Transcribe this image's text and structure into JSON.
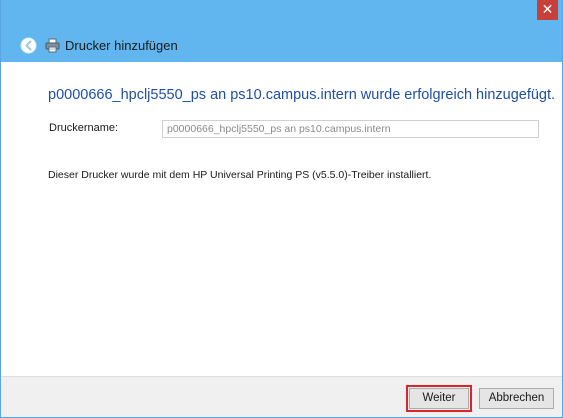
{
  "window": {
    "title": "Drucker hinzufügen",
    "close_symbol": "✕"
  },
  "content": {
    "headline": "p0000666_hpclj5550_ps an ps10.campus.intern wurde erfolgreich hinzugefügt.",
    "printer_name_label": "Druckername:",
    "printer_name_value": "p0000666_hpclj5550_ps an ps10.campus.intern",
    "info_text": "Dieser Drucker wurde mit dem HP Universal Printing PS (v5.5.0)-Treiber installiert."
  },
  "footer": {
    "next_label": "Weiter",
    "cancel_label": "Abbrechen"
  },
  "colors": {
    "titlebar": "#61b6f0",
    "close_button": "#c7413a",
    "headline": "#1e4fa3",
    "highlight": "#d9262c"
  },
  "icons": {
    "back": "back-arrow-icon",
    "printer": "printer-icon",
    "close": "close-icon"
  }
}
